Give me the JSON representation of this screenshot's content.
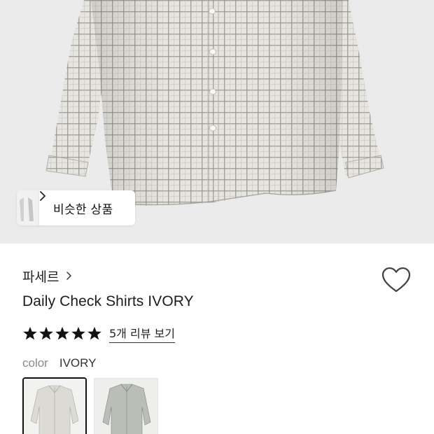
{
  "hero": {
    "similar_products": {
      "label": "비슷한 상품",
      "chevron_icon": "chevron-right-icon"
    }
  },
  "product": {
    "brand": "파세르",
    "brand_chevron_icon": "chevron-right-icon",
    "wishlist_icon": "heart-outline-icon",
    "title": "Daily Check Shirts IVORY",
    "rating": {
      "stars_filled": 5,
      "stars_total": 5,
      "star_icon": "star-icon",
      "review_link": "5개 리뷰 보기"
    },
    "color": {
      "label": "color",
      "selected_value": "IVORY",
      "options": [
        {
          "name": "IVORY",
          "selected": true,
          "thumb_color": "#dcdad4"
        },
        {
          "name": "other",
          "selected": false,
          "thumb_color": "#b9bfb6"
        }
      ]
    }
  },
  "colors": {
    "background": "#ffffff",
    "hero_background": "#ebebeb",
    "shirt_base": "#e4e2dc",
    "check_line": "#8d8d87",
    "text_primary": "#1c1c1c",
    "text_muted": "#8a8a8a"
  }
}
